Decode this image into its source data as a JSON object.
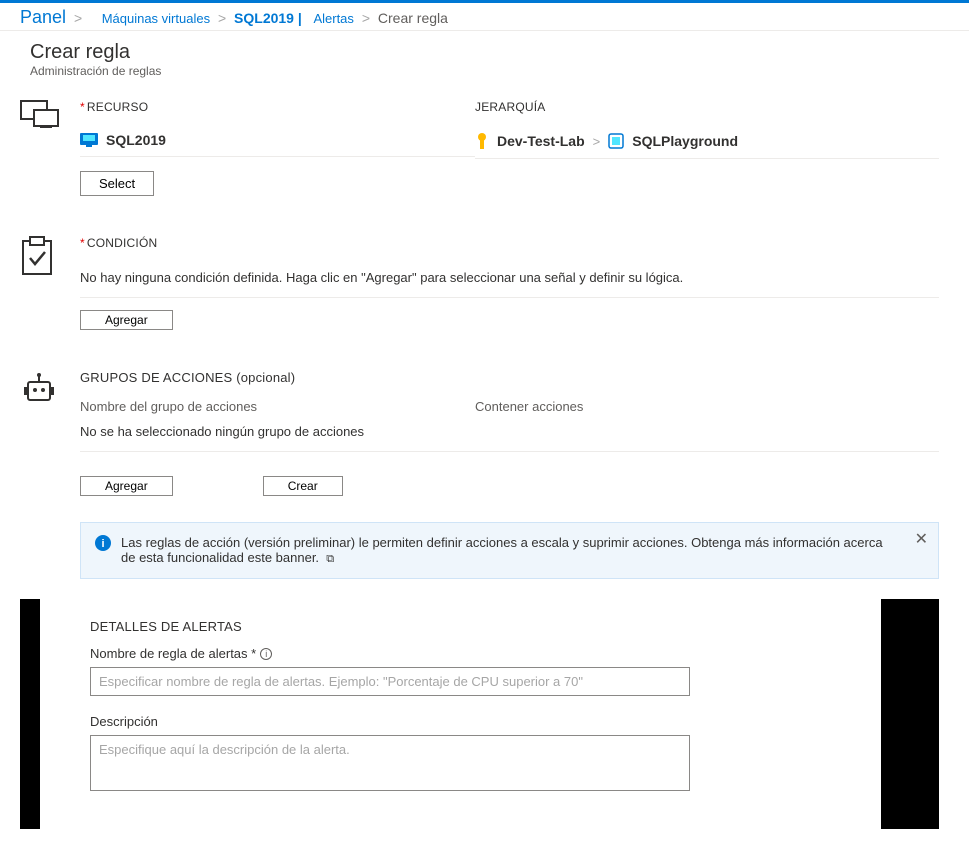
{
  "breadcrumb": {
    "panel": "Panel",
    "items": [
      {
        "label": "Máquinas virtuales"
      },
      {
        "label": "SQL2019 |",
        "bold": true
      },
      {
        "label": "Alertas"
      }
    ],
    "current": "Crear regla"
  },
  "page": {
    "title": "Crear regla",
    "subtitle": "Administración de reglas"
  },
  "resource": {
    "label": "RECURSO",
    "name": "SQL2019",
    "select_button": "Select"
  },
  "hierarchy": {
    "label": "JERARQUÍA",
    "items": [
      "Dev-Test-Lab",
      "SQLPlayground"
    ]
  },
  "condition": {
    "label": "CONDICIÓN",
    "empty_text": "No hay ninguna condición definida. Haga clic en \"Agregar\" para seleccionar una señal y definir su lógica.",
    "add_button": "Agregar"
  },
  "action_groups": {
    "header": "GRUPOS DE ACCIONES (opcional)",
    "col1": "Nombre del grupo de acciones",
    "col2": "Contener acciones",
    "empty_text": "No se ha seleccionado ningún grupo de acciones",
    "add_button": "Agregar",
    "create_button": "Crear"
  },
  "banner": {
    "text": "Las reglas de acción (versión preliminar) le permiten definir acciones a escala y suprimir acciones. Obtenga más información acerca de esta funcionalidad este banner."
  },
  "details": {
    "header": "DETALLES DE ALERTAS",
    "rule_name_label": "Nombre de regla de alertas *",
    "rule_name_placeholder": "Especificar nombre de regla de alertas. Ejemplo: \"Porcentaje de CPU superior a 70\"",
    "rule_name_value": "",
    "description_label": "Descripción",
    "description_placeholder": "Especifique aquí la descripción de la alerta.",
    "description_value": ""
  }
}
